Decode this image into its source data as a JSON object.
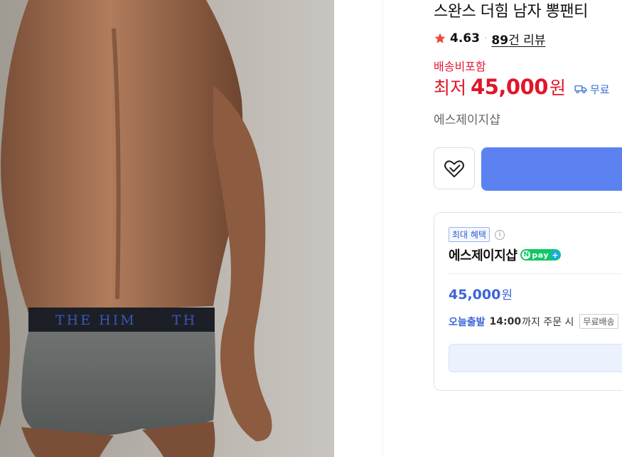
{
  "product": {
    "title": "스완스 더힘 남자 뽕팬티",
    "rating": "4.63",
    "separator": "·",
    "review_count": "89",
    "review_suffix": "건 리뷰",
    "shipping_included": "배송비포함",
    "price_prefix": "최저",
    "price": "45,000",
    "price_unit": "원",
    "shipping_fee": "무료",
    "seller": "에스제이지샵",
    "waistband_text": "THE HIM",
    "waistband_text_2": "TH"
  },
  "benefit_card": {
    "badge": "최대 혜택",
    "info_symbol": "i",
    "store_name": "에스제이지샵",
    "npay_n": "N",
    "npay_label": "pay",
    "npay_plus": "+",
    "price": "45,000",
    "price_unit": "원",
    "dispatch_label": "오늘출발",
    "dispatch_time": "14:00",
    "dispatch_suffix": "까지 주문 시",
    "free_shipping_badge": "무료배송"
  },
  "colors": {
    "price_red": "#e0162b",
    "accent_blue": "#5b82f0",
    "benefit_blue": "#3b64d8",
    "npay_green": "#10c763"
  },
  "icons": [
    "star-icon",
    "truck-icon",
    "heart-check-icon",
    "info-icon",
    "npay-plus-icon"
  ]
}
